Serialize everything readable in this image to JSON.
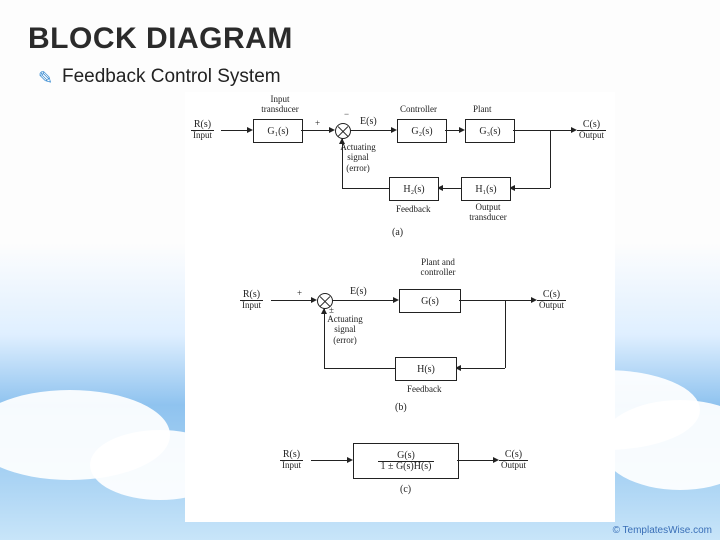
{
  "title": "BLOCK DIAGRAM",
  "subtitle": "Feedback Control System",
  "credit": "© TemplatesWise.com",
  "a": {
    "label": "(a)",
    "input_transducer": "Input\ntransducer",
    "controller": "Controller",
    "plant": "Plant",
    "feedback": "Feedback",
    "output_transducer": "Output\ntransducer",
    "actuating": "Actuating\nsignal\n(error)",
    "R": "R(s)",
    "R_sub": "Input",
    "E": "E(s)",
    "C": "C(s)",
    "C_sub": "Output",
    "G1": "G₁(s)",
    "G2": "G₂(s)",
    "G3": "G₃(s)",
    "H1": "H₁(s)",
    "H2": "H₂(s)",
    "plus": "+",
    "minus": "−"
  },
  "b": {
    "label": "(b)",
    "plant_controller": "Plant and\ncontroller",
    "feedback": "Feedback",
    "actuating": "Actuating\nsignal\n(error)",
    "R": "R(s)",
    "R_sub": "Input",
    "E": "E(s)",
    "C": "C(s)",
    "C_sub": "Output",
    "G": "G(s)",
    "H": "H(s)",
    "plus": "+",
    "minus": "±"
  },
  "c": {
    "label": "(c)",
    "R": "R(s)",
    "R_sub": "Input",
    "C": "C(s)",
    "C_sub": "Output",
    "num": "G(s)",
    "den": "1 ± G(s)H(s)"
  }
}
